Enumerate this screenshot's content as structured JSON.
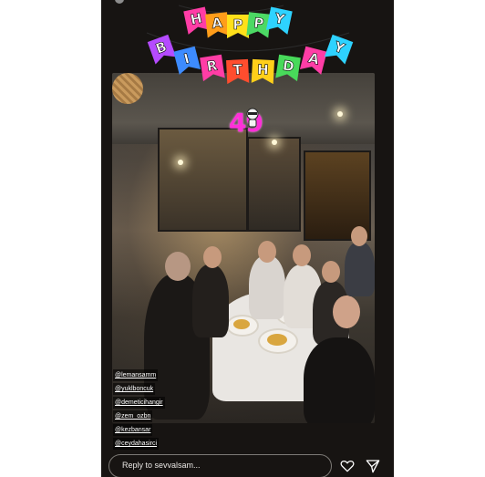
{
  "banner": {
    "word1": [
      "H",
      "A",
      "P",
      "P",
      "Y"
    ],
    "word2": [
      "B",
      "I",
      "R",
      "T",
      "H",
      "D",
      "A",
      "Y"
    ],
    "word1_colors": [
      "#ff3da6",
      "#ff9d1a",
      "#ffe01a",
      "#4cd964",
      "#2ed2ff"
    ],
    "word2_colors": [
      "#b54bff",
      "#3d8bff",
      "#ff3da6",
      "#ff4d2e",
      "#ffcf1a",
      "#48d95a",
      "#ff3da6",
      "#2ed2ff"
    ]
  },
  "age_sticker": "49",
  "tags": [
    "@lemansamm",
    "@yuklboncuk",
    "@demeticihangir",
    "@zem_ozbn",
    "@kezbansar",
    "@ceydahasirci"
  ],
  "reply": {
    "placeholder": "Reply to sevvalsam..."
  },
  "icons": {
    "like": "heart-icon",
    "share": "send-icon"
  }
}
